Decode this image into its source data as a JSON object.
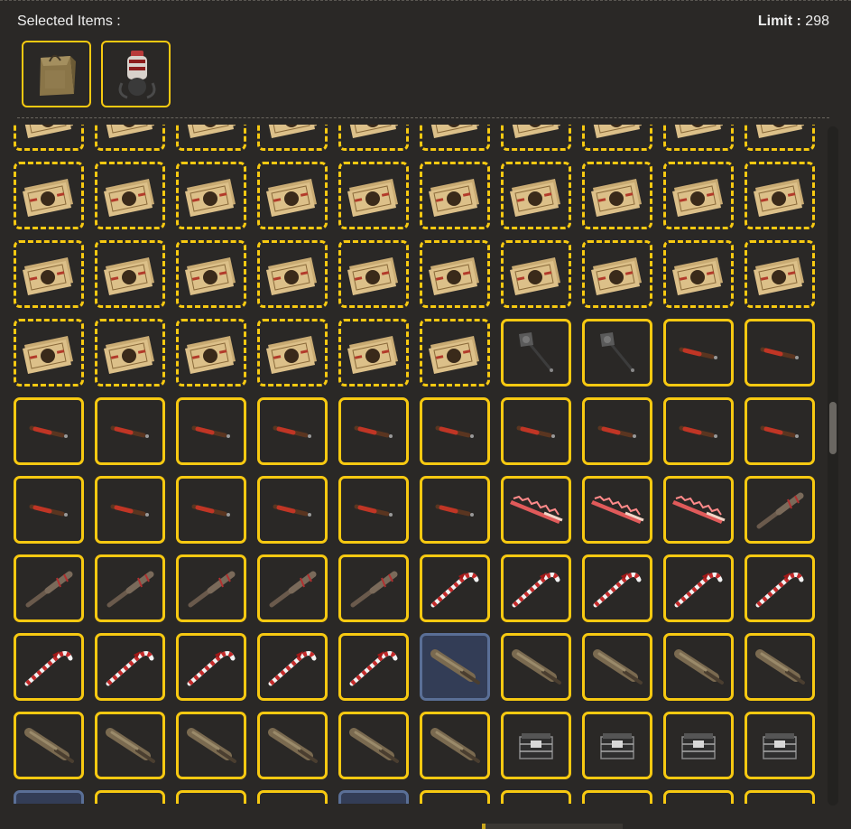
{
  "header": {
    "selected_label": "Selected Items :",
    "limit_label": "Limit :",
    "limit_value": "298"
  },
  "selected_items": [
    {
      "icon": "paper-bag-icon"
    },
    {
      "icon": "robot-backpack-icon"
    }
  ],
  "grid": {
    "columns": 10,
    "rows": [
      [
        "ticket-d",
        "ticket-d",
        "ticket-d",
        "ticket-d",
        "ticket-d",
        "ticket-d",
        "ticket-d",
        "ticket-d",
        "ticket-d",
        "ticket-d"
      ],
      [
        "ticket-d",
        "ticket-d",
        "ticket-d",
        "ticket-d",
        "ticket-d",
        "ticket-d",
        "ticket-d",
        "ticket-d",
        "ticket-d",
        "ticket-d"
      ],
      [
        "ticket-d",
        "ticket-d",
        "ticket-d",
        "ticket-d",
        "ticket-d",
        "ticket-d",
        "ticket-d",
        "ticket-d",
        "ticket-d",
        "ticket-d"
      ],
      [
        "ticket-d",
        "ticket-d",
        "ticket-d",
        "ticket-d",
        "ticket-d",
        "ticket-d",
        "axe",
        "axe",
        "bat-red",
        "bat-red"
      ],
      [
        "bat-red",
        "bat-red",
        "bat-red",
        "bat-red",
        "bat-red",
        "bat-red",
        "bat-red",
        "bat-red",
        "bat-red",
        "bat-red"
      ],
      [
        "bat-red",
        "bat-red",
        "bat-red",
        "bat-red",
        "bat-red",
        "bat-red",
        "lobster",
        "lobster",
        "lobster",
        "nail-bat"
      ],
      [
        "nail-bat",
        "nail-bat",
        "nail-bat",
        "nail-bat",
        "nail-bat",
        "candy-cane",
        "candy-cane",
        "candy-cane",
        "candy-cane",
        "candy-cane"
      ],
      [
        "candy-cane",
        "candy-cane",
        "candy-cane",
        "candy-cane",
        "candy-cane",
        "bat-wood-blue",
        "bat-wood",
        "bat-wood",
        "bat-wood",
        "bat-wood"
      ],
      [
        "bat-wood",
        "bat-wood",
        "bat-wood",
        "bat-wood",
        "bat-wood",
        "bat-wood",
        "crate",
        "crate",
        "crate",
        "crate"
      ],
      [
        "blue-empty",
        "empty",
        "empty",
        "empty",
        "blue-empty",
        "empty",
        "empty",
        "empty",
        "empty",
        "empty"
      ]
    ]
  },
  "colors": {
    "background": "#2a2826",
    "accent_border": "#f7c911",
    "selected_blue": "#333d56"
  }
}
